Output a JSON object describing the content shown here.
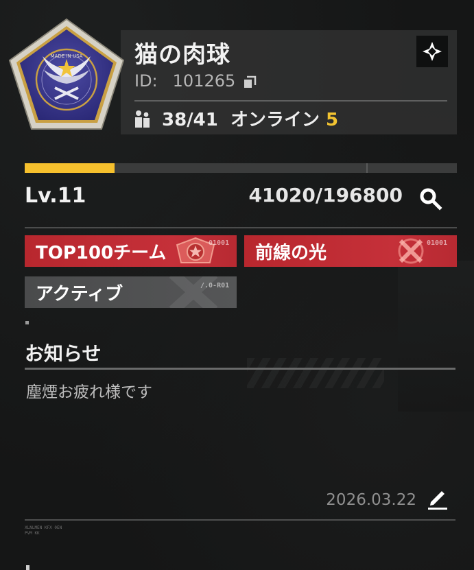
{
  "guild": {
    "name": "猫の肉球",
    "id_label": "ID:",
    "id_value": "101265",
    "members": "38/41",
    "online_label": "オンライン",
    "online_count": "5",
    "emblem_text": "MADE IN USA"
  },
  "level": {
    "label": "Lv.11",
    "xp_text": "41020/196800",
    "xp_progress": 0.2085
  },
  "tags": [
    {
      "label": "TOP100チーム",
      "code": "01001",
      "style": "red",
      "icon": "star-shield-icon"
    },
    {
      "label": "前線の光",
      "code": "01001",
      "style": "red",
      "icon": "crossed-swords-icon"
    },
    {
      "label": "アクティブ",
      "code": "/.0-R01",
      "style": "gray",
      "icon": "x-mark-icon"
    }
  ],
  "notice": {
    "title": "お知らせ",
    "body": "塵煙お疲れ様です",
    "date": "2026.03.22"
  },
  "footer": {
    "code_line1": "XLNLMEN KFX 0EN",
    "code_line2": "PVM KK"
  },
  "colors": {
    "accent_yellow": "#f6c02d",
    "tag_red": "#c53039",
    "tag_gray": "#555657"
  }
}
